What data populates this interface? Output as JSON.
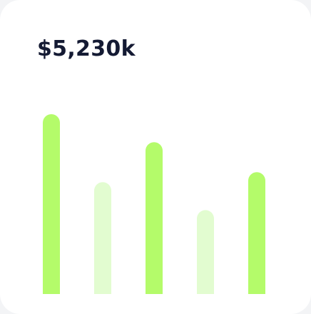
{
  "amount_label": "$5,230k",
  "colors": {
    "bar_primary": "#b4fb6a",
    "bar_secondary": "#e2fcd0",
    "text": "#141a33",
    "card": "#ffffff"
  },
  "chart_data": {
    "type": "bar",
    "categories": [
      "",
      "",
      "",
      "",
      ""
    ],
    "values": [
      100,
      66,
      86,
      52,
      71
    ],
    "ylim": [
      0,
      100
    ],
    "bar_styles": [
      "primary",
      "secondary",
      "primary",
      "secondary",
      "primary"
    ],
    "axes_visible": false,
    "grid": false
  }
}
